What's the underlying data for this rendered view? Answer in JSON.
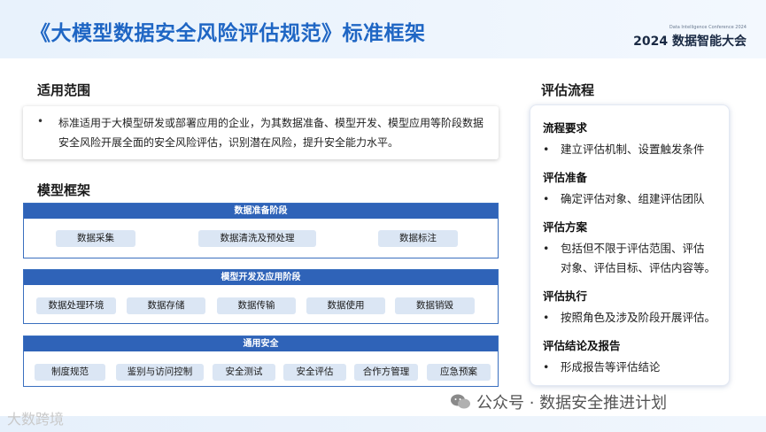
{
  "header": {
    "title": "《大模型数据安全风险评估规范》标准框架",
    "conference_small": "Data Intelligence Conference 2024",
    "conference_big": "2024 数据智能大会"
  },
  "scope": {
    "heading": "适用范围",
    "bullet": "•",
    "text": "标准适用于大模型研发或部署应用的企业，为其数据准备、模型开发、模型应用等阶段数据安全风险开展全面的安全风险评估，识别潜在风险，提升安全能力水平。"
  },
  "framework": {
    "heading": "模型框架",
    "stages": [
      {
        "title": "数据准备阶段",
        "items": [
          "数据采集",
          "数据清洗及预处理",
          "数据标注"
        ]
      },
      {
        "title": "模型开发及应用阶段",
        "items": [
          "数据处理环境",
          "数据存储",
          "数据传输",
          "数据使用",
          "数据销毁"
        ]
      },
      {
        "title": "通用安全",
        "items": [
          "制度规范",
          "鉴别与访问控制",
          "安全测试",
          "安全评估",
          "合作方管理",
          "应急预案"
        ]
      }
    ]
  },
  "flow": {
    "heading": "评估流程",
    "bullet": "•",
    "steps": [
      {
        "title": "流程要求",
        "desc": [
          "建立评估机制、设置触发条件"
        ]
      },
      {
        "title": "评估准备",
        "desc": [
          "确定评估对象、组建评估团队"
        ]
      },
      {
        "title": "评估方案",
        "desc": [
          "包括但不限于评估范围、评估",
          "对象、评估目标、评估内容等。"
        ]
      },
      {
        "title": "评估执行",
        "desc": [
          "按照角色及涉及阶段开展评估。"
        ]
      },
      {
        "title": "评估结论及报告",
        "desc": [
          "形成报告等评估结论"
        ]
      }
    ]
  },
  "watermarks": {
    "left": "大数跨境",
    "right": "公众号 · 数据安全推进计划",
    "right_icon": "wechat-icon"
  },
  "colors": {
    "title": "#1f66c4",
    "stage_header": "#2f63b8",
    "chip_bg": "#dbe6f4"
  }
}
